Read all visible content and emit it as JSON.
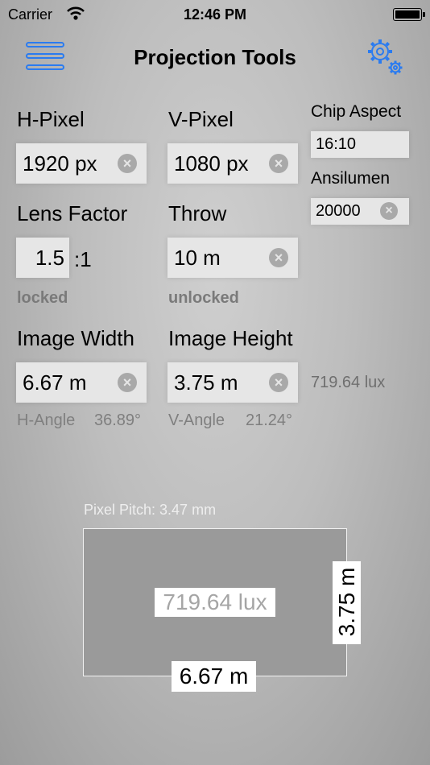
{
  "status_bar": {
    "carrier": "Carrier",
    "time": "12:46 PM"
  },
  "nav": {
    "title": "Projection Tools"
  },
  "h_pixel": {
    "label": "H-Pixel",
    "value": "1920 px"
  },
  "v_pixel": {
    "label": "V-Pixel",
    "value": "1080 px"
  },
  "chip_aspect": {
    "label": "Chip Aspect",
    "value": "16:10"
  },
  "ansilumen": {
    "label": "Ansilumen",
    "value": "20000"
  },
  "lens_factor": {
    "label": "Lens Factor",
    "value": "1.5",
    "suffix": ":1",
    "state": "locked"
  },
  "throw": {
    "label": "Throw",
    "value": "10 m",
    "state": "unlocked"
  },
  "image_width": {
    "label": "Image Width",
    "value": "6.67 m",
    "angle_label": "H-Angle",
    "angle_value": "36.89°"
  },
  "image_height": {
    "label": "Image Height",
    "value": "3.75 m",
    "angle_label": "V-Angle",
    "angle_value": "21.24°"
  },
  "lux": "719.64 lux",
  "preview": {
    "pixel_pitch": "Pixel Pitch: 3.47 mm",
    "lux": "719.64 lux",
    "width": "6.67 m",
    "height": "3.75 m"
  },
  "colors": {
    "accent": "#2a7bf0",
    "field_bg": "#e6e6e6",
    "muted_text": "#7a7a7a"
  },
  "icons": [
    "wifi-icon",
    "battery-icon",
    "menu-icon",
    "gear-icon",
    "clear-icon"
  ]
}
